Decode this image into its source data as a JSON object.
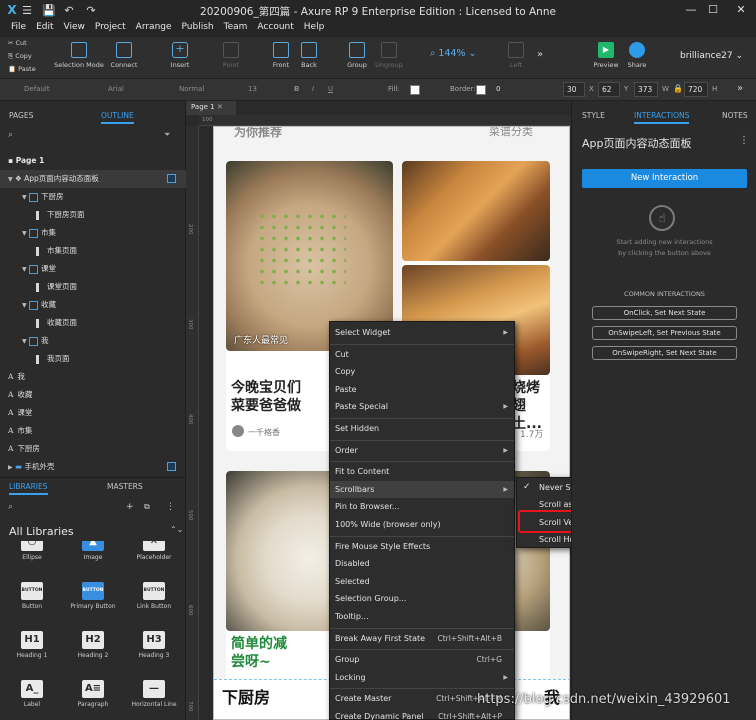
{
  "window": {
    "title": "20200906_第四篇 - Axure RP 9 Enterprise Edition : Licensed to Anne",
    "controls": [
      "—",
      "☐",
      "✕"
    ]
  },
  "menubar": [
    "File",
    "Edit",
    "View",
    "Project",
    "Arrange",
    "Publish",
    "Team",
    "Account",
    "Help"
  ],
  "clipboard": {
    "cut": "Cut",
    "copy": "Copy",
    "paste": "Paste"
  },
  "toolbar": {
    "selection_mode": "Selection Mode",
    "connect": "Connect",
    "insert": "Insert",
    "point": "Point",
    "front": "Front",
    "back": "Back",
    "group": "Group",
    "ungroup": "Ungroup",
    "zoom": "144%",
    "left": "Left",
    "preview": "Preview",
    "share": "Share",
    "user": "brilliance27"
  },
  "stylebar": {
    "style": "Default",
    "font": "Arial",
    "weight": "Normal",
    "size": "13",
    "fill_label": "Fill:",
    "border_label": "Border:",
    "border_value": "0",
    "x": "30",
    "x_label": "X",
    "y": "62",
    "y_label": "Y",
    "w": "373",
    "w_label": "W",
    "h": "720",
    "h_label": "H"
  },
  "left_panel": {
    "tabs": [
      "PAGES",
      "OUTLINE"
    ],
    "page_title": "Page 1",
    "outline": [
      {
        "label": "App页面内容动态面板",
        "level": 0,
        "type": "panel",
        "selected": true
      },
      {
        "label": "下厨房",
        "level": 1,
        "type": "state"
      },
      {
        "label": "下厨房页面",
        "level": 2,
        "type": "page"
      },
      {
        "label": "市集",
        "level": 1,
        "type": "state"
      },
      {
        "label": "市集页面",
        "level": 2,
        "type": "page"
      },
      {
        "label": "课堂",
        "level": 1,
        "type": "state"
      },
      {
        "label": "课堂页面",
        "level": 2,
        "type": "page"
      },
      {
        "label": "收藏",
        "level": 1,
        "type": "state"
      },
      {
        "label": "收藏页面",
        "level": 2,
        "type": "page"
      },
      {
        "label": "我",
        "level": 1,
        "type": "state"
      },
      {
        "label": "我页面",
        "level": 2,
        "type": "page"
      },
      {
        "label": "我",
        "level": 0,
        "type": "text"
      },
      {
        "label": "收藏",
        "level": 0,
        "type": "text"
      },
      {
        "label": "课堂",
        "level": 0,
        "type": "text"
      },
      {
        "label": "市集",
        "level": 0,
        "type": "text"
      },
      {
        "label": "下厨房",
        "level": 0,
        "type": "text"
      },
      {
        "label": "手机外壳",
        "level": 0,
        "type": "folder"
      }
    ],
    "library_tabs": [
      "LIBRARIES",
      "MASTERS"
    ],
    "library_name": "All Libraries",
    "library_items": [
      {
        "label": "Ellipse",
        "glyph": "○"
      },
      {
        "label": "Image",
        "glyph": "▲"
      },
      {
        "label": "Placeholder",
        "glyph": "✕"
      },
      {
        "label": "Button",
        "glyph": "BUTTON"
      },
      {
        "label": "Primary Button",
        "glyph": "BUTTON"
      },
      {
        "label": "Link Button",
        "glyph": "BUTTON"
      },
      {
        "label": "Heading 1",
        "glyph": "H1"
      },
      {
        "label": "Heading 2",
        "glyph": "H2"
      },
      {
        "label": "Heading 3",
        "glyph": "H3"
      },
      {
        "label": "Label",
        "glyph": "A_"
      },
      {
        "label": "Paragraph",
        "glyph": "A≡"
      },
      {
        "label": "Horizontal Line",
        "glyph": "—"
      }
    ]
  },
  "canvas": {
    "tab": "Page 1",
    "ruler_top": [
      "100"
    ],
    "ruler_left": [
      "200",
      "300",
      "400",
      "500",
      "600",
      "700"
    ],
    "phone": {
      "top_text_left": "为你推荐",
      "top_text_right": "菜谱分类",
      "card1_caption": "广东人最常见",
      "card1_title": "今晚宝贝们\n菜要爸爸做",
      "card1_author": "一千格香",
      "card2_title": "烧烤\n翅土...",
      "card2_count": "1.7万",
      "card3_title": "简单的减\n尝呀~",
      "tab_left": "下厨房",
      "tab_right": "我"
    }
  },
  "context_menu": [
    {
      "label": "Select Widget",
      "sub": true
    },
    {
      "sep": true
    },
    {
      "label": "Cut"
    },
    {
      "label": "Copy"
    },
    {
      "label": "Paste"
    },
    {
      "label": "Paste Special",
      "sub": true
    },
    {
      "sep": true
    },
    {
      "label": "Set Hidden"
    },
    {
      "sep": true
    },
    {
      "label": "Order",
      "sub": true
    },
    {
      "sep": true
    },
    {
      "label": "Fit to Content"
    },
    {
      "label": "Scrollbars",
      "sub": true,
      "hl": true
    },
    {
      "label": "Pin to Browser..."
    },
    {
      "label": "100% Wide (browser only)"
    },
    {
      "sep": true
    },
    {
      "label": "Fire Mouse Style Effects"
    },
    {
      "label": "Disabled"
    },
    {
      "label": "Selected"
    },
    {
      "label": "Selection Group..."
    },
    {
      "label": "Tooltip..."
    },
    {
      "sep": true
    },
    {
      "label": "Break Away First State",
      "short": "Ctrl+Shift+Alt+B"
    },
    {
      "sep": true
    },
    {
      "label": "Group",
      "short": "Ctrl+G"
    },
    {
      "label": "Locking",
      "sub": true
    },
    {
      "sep": true
    },
    {
      "label": "Create Master",
      "short": "Ctrl+Shift+Alt+M"
    },
    {
      "label": "Create Dynamic Panel",
      "short": "Ctrl+Shift+Alt+P"
    }
  ],
  "scroll_submenu": [
    {
      "label": "Never Scroll",
      "checked": true
    },
    {
      "label": "Scroll as Needed"
    },
    {
      "label": "Scroll Vertical",
      "highlighted": true
    },
    {
      "label": "Scroll Horizontal"
    }
  ],
  "right_panel": {
    "tabs": [
      "STYLE",
      "INTERACTIONS",
      "NOTES"
    ],
    "widget_name": "App页面内容动态面板",
    "new_interaction": "New Interaction",
    "hint": "Start adding new interactions\nby clicking the button above",
    "common_title": "COMMON INTERACTIONS",
    "common": [
      "OnClick, Set Next State",
      "OnSwipeLeft, Set Previous State",
      "OnSwipeRight, Set Next State"
    ]
  },
  "watermark": "https://blog.csdn.net/weixin_43929601",
  "colors": {
    "accent": "#1a8ae0",
    "highlight_box": "#e8141c",
    "tab_active": "#3aa0f0"
  }
}
